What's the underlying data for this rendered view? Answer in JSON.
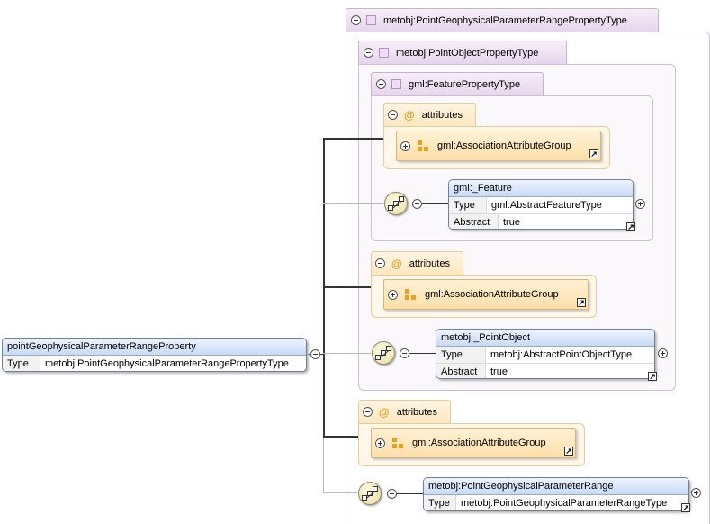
{
  "root": {
    "name": "pointGeophysicalParameterRangeProperty",
    "type_key": "Type",
    "type_value": "metobj:PointGeophysicalParameterRangePropertyType"
  },
  "types": {
    "outer": "metobj:PointGeophysicalParameterRangePropertyType",
    "point_object": "metobj:PointObjectPropertyType",
    "feature": "gml:FeaturePropertyType"
  },
  "attributes_label": "attributes",
  "group_name": "gml:AssociationAttributeGroup",
  "feature_elem": {
    "name": "gml:_Feature",
    "type_key": "Type",
    "type_value": "gml:AbstractFeatureType",
    "abstract_key": "Abstract",
    "abstract_value": "true"
  },
  "point_elem": {
    "name": "metobj:_PointObject",
    "type_key": "Type",
    "type_value": "metobj:AbstractPointObjectType",
    "abstract_key": "Abstract",
    "abstract_value": "true"
  },
  "range_elem": {
    "name": "metobj:PointGeophysicalParameterRange",
    "type_key": "Type",
    "type_value": "metobj:PointGeophysicalParameterRangeType"
  },
  "icons": {
    "collapse": "collapse-icon",
    "expand": "expand-icon",
    "sequence": "sequence-compositor-icon",
    "link": "go-to-definition-icon",
    "complex_type": "complex-type-icon",
    "attribute_group": "attribute-group-icon"
  },
  "colors": {
    "complex_type_tab": "#e7d6ec",
    "attribute_tab": "#fde7bf",
    "element_header": "#c8daf6"
  }
}
